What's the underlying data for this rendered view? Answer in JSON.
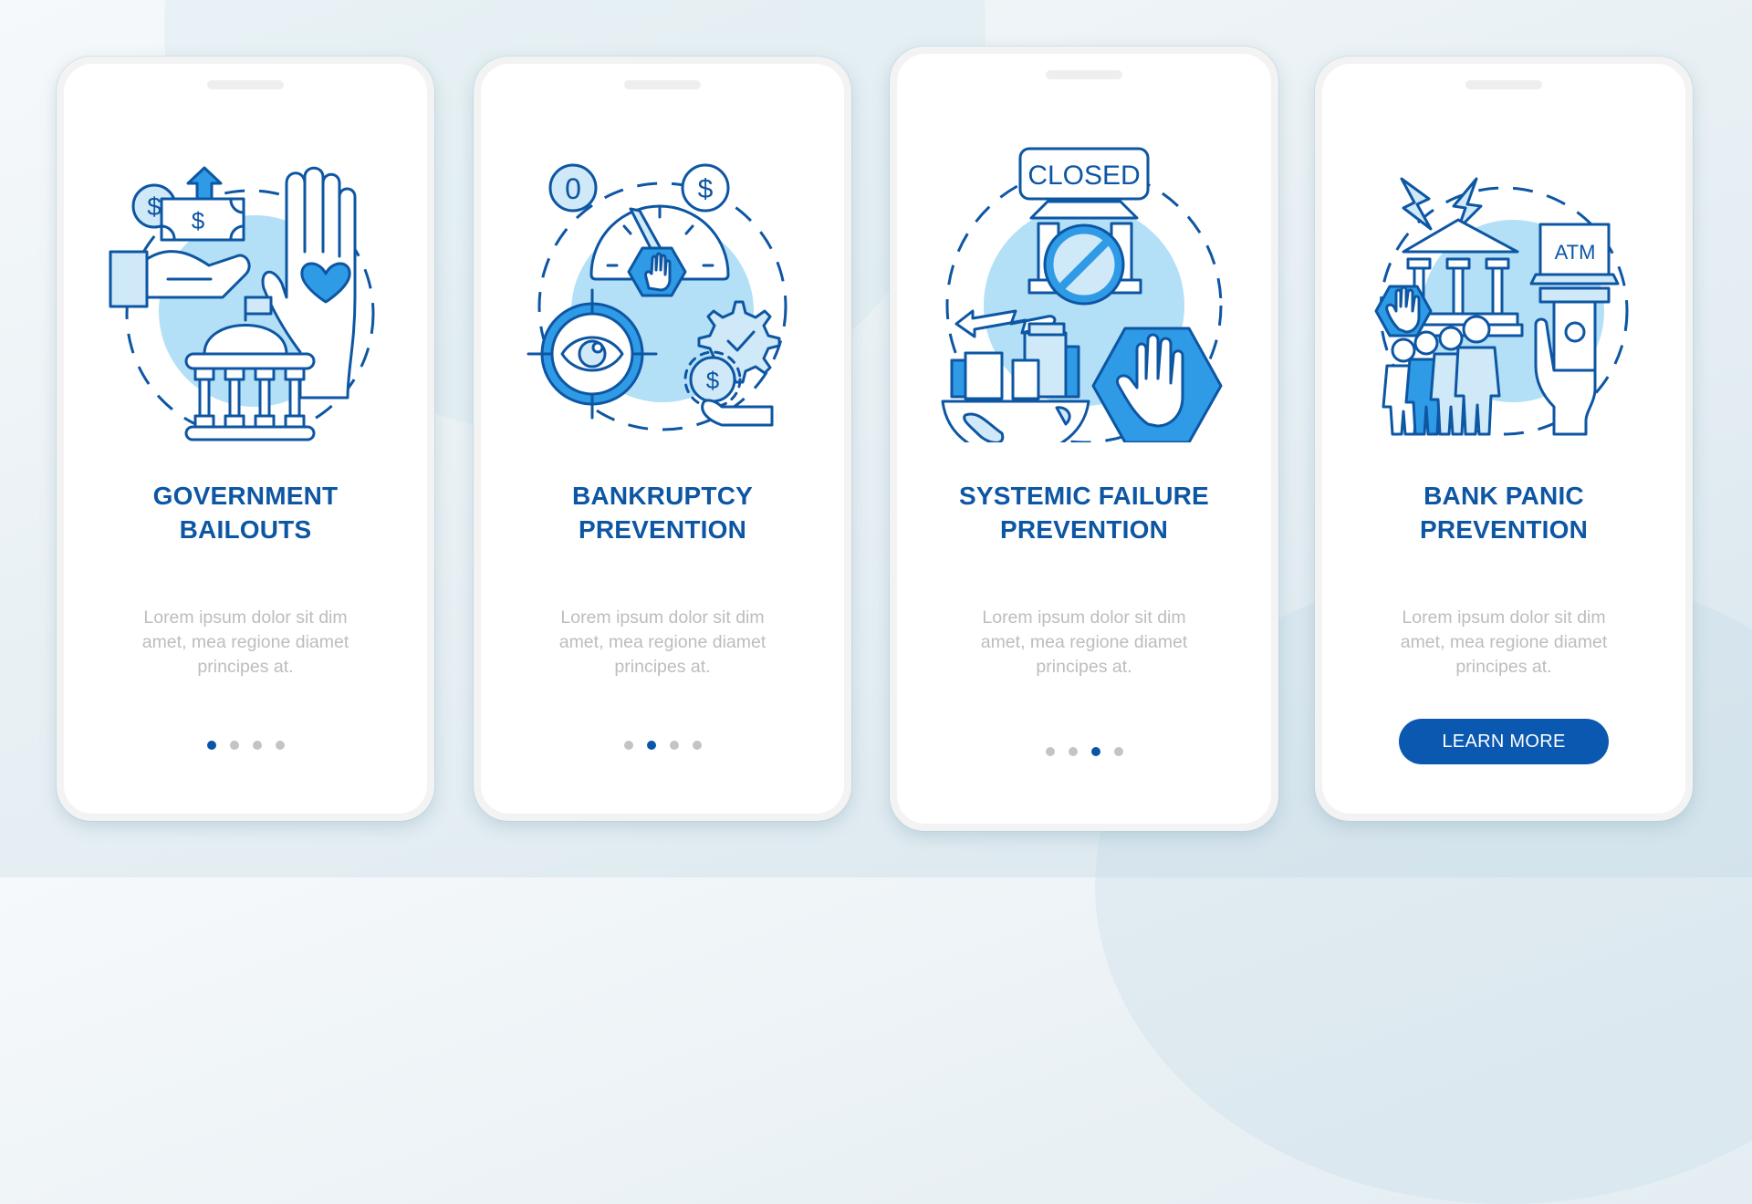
{
  "colors": {
    "title": "#0d56a3",
    "body_text": "#bdbdbd",
    "dot_active": "#0a55a8",
    "dot_inactive": "#c4c4c4",
    "button": "#0a58b0",
    "icon_stroke": "#0d56a3",
    "icon_fill_light": "#b3e0f7",
    "icon_fill_medium": "#2f9be6"
  },
  "screens": [
    {
      "title_lines": [
        "GOVERNMENT",
        "BAILOUTS"
      ],
      "body_lines": [
        "Lorem ipsum dolor sit dim",
        "amet, mea regione diamet",
        "principes at."
      ],
      "icon": "government-bailouts-illustration",
      "page_index": 1,
      "page_count": 4
    },
    {
      "title_lines": [
        "BANKRUPTCY",
        "PREVENTION"
      ],
      "body_lines": [
        "Lorem ipsum dolor sit dim",
        "amet, mea regione diamet",
        "principes at."
      ],
      "icon": "bankruptcy-prevention-illustration",
      "illustration_text": {
        "coin_left": "0",
        "coin_right": "$"
      },
      "page_index": 2,
      "page_count": 4
    },
    {
      "title_lines": [
        "SYSTEMIC FAILURE",
        "PREVENTION"
      ],
      "body_lines": [
        "Lorem ipsum dolor sit dim",
        "amet, mea regione diamet",
        "principes at."
      ],
      "icon": "systemic-failure-prevention-illustration",
      "illustration_text": {
        "sign": "CLOSED"
      },
      "page_index": 3,
      "page_count": 4
    },
    {
      "title_lines": [
        "BANK PANIC",
        "PREVENTION"
      ],
      "body_lines": [
        "Lorem ipsum dolor sit dim",
        "amet, mea regione diamet",
        "principes at."
      ],
      "icon": "bank-panic-prevention-illustration",
      "illustration_text": {
        "atm": "ATM"
      },
      "button_label": "LEARN MORE"
    }
  ]
}
